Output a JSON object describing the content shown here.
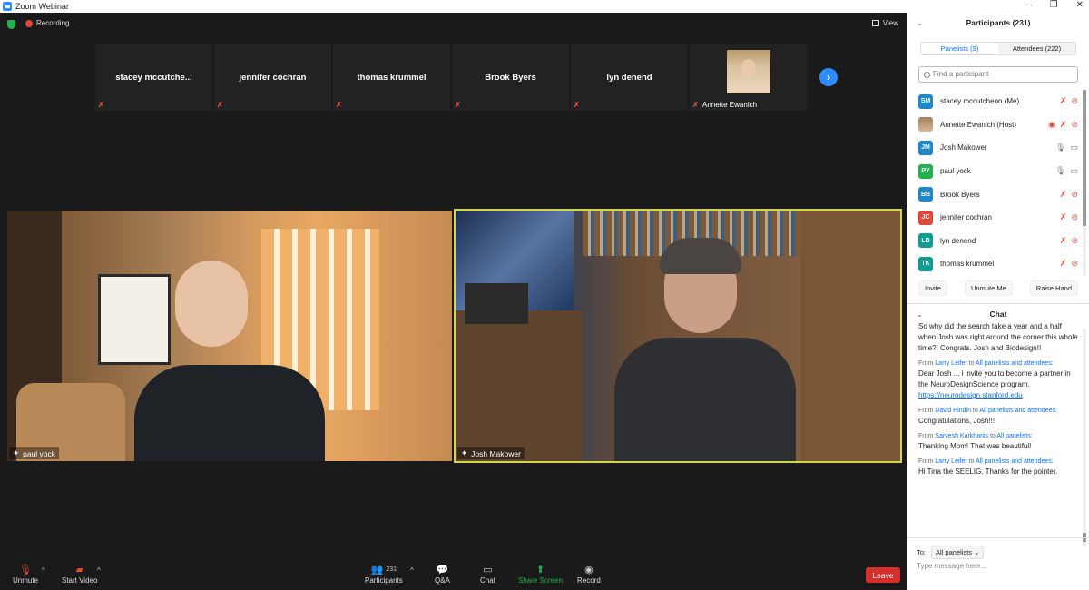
{
  "window": {
    "title": "Zoom Webinar"
  },
  "topbar": {
    "recording_label": "Recording",
    "view_label": "View"
  },
  "gallery": [
    {
      "name": "stacey  mccutche...",
      "has_photo": false
    },
    {
      "name": "jennifer cochran",
      "has_photo": false
    },
    {
      "name": "thomas krummel",
      "has_photo": false
    },
    {
      "name": "Brook Byers",
      "has_photo": false
    },
    {
      "name": "lyn denend",
      "has_photo": false
    },
    {
      "name": "Annette Ewanich",
      "has_photo": true
    }
  ],
  "videos": [
    {
      "name": "paul yock"
    },
    {
      "name": "Josh Makower"
    }
  ],
  "toolbar": {
    "unmute": "Unmute",
    "start_video": "Start Video",
    "participants": "Participants",
    "participants_count": "231",
    "qa": "Q&A",
    "chat": "Chat",
    "share_screen": "Share Screen",
    "record": "Record",
    "leave": "Leave"
  },
  "panel": {
    "title": "Participants (231)",
    "tabs": [
      "Panelists (9)",
      "Attendees (222)"
    ],
    "search_placeholder": "Find a participant",
    "participants": [
      {
        "initials": "SM",
        "name": "stacey mccutcheon (Me)",
        "color": "#1e88c9",
        "mic": "muted",
        "video": "off"
      },
      {
        "initials": "",
        "name": "Annette Ewanich (Host)",
        "color": "#a07f5a",
        "mic": "muted",
        "video": "off"
      },
      {
        "initials": "JM",
        "name": "Josh Makower",
        "color": "#1e88c9",
        "mic": "on",
        "video": "on"
      },
      {
        "initials": "PY",
        "name": "paul yock",
        "color": "#23b14d",
        "mic": "on",
        "video": "on"
      },
      {
        "initials": "BB",
        "name": "Brook Byers",
        "color": "#1e88c9",
        "mic": "muted",
        "video": "off"
      },
      {
        "initials": "JC",
        "name": "jennifer cochran",
        "color": "#e0493b",
        "mic": "muted",
        "video": "off"
      },
      {
        "initials": "LD",
        "name": "lyn denend",
        "color": "#0f9d8f",
        "mic": "muted",
        "video": "off"
      },
      {
        "initials": "TK",
        "name": "thomas krummel",
        "color": "#0f9d8f",
        "mic": "muted",
        "video": "off"
      }
    ],
    "buttons": [
      "Invite",
      "Unmute Me",
      "Raise Hand"
    ]
  },
  "chat": {
    "title": "Chat",
    "messages": [
      {
        "from": "",
        "to": "",
        "text": "So why did the search take a year and a half when Josh was right around the corner this whole time?! Congrats. Josh and Biodesign!!",
        "link": ""
      },
      {
        "from": "Larry Leifer",
        "to": "All panelists and attendees:",
        "text": "Dear Josh ... i invite you to become a partner in the NeuroDesignScience program.",
        "link": "https://neurodesign.stanford.edu"
      },
      {
        "from": "David Hindin",
        "to": "All panelists and attendees:",
        "text": "Congratulations, Josh!!!",
        "link": ""
      },
      {
        "from": "Sarvesh Karkhanis",
        "to": "All panelists:",
        "text": "Thanking Mom! That was beautiful!",
        "link": ""
      },
      {
        "from": "Larry Leifer",
        "to": "All panelists and attendees:",
        "text": "Hi Tina the SEELIG.  Thanks for the pointer.",
        "link": ""
      }
    ],
    "to_label": "To:",
    "to_value": "All panelists",
    "input_placeholder": "Type message here..."
  }
}
